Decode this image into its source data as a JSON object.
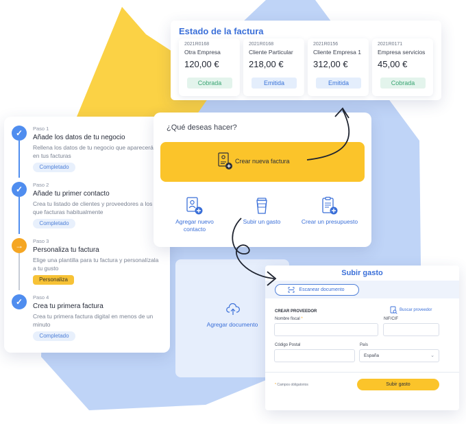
{
  "invoice_status": {
    "title": "Estado de la factura",
    "invoices": [
      {
        "id": "2021R0168",
        "client": "Otra Empresa",
        "amount": "120,00 €",
        "status": "Cobrada",
        "status_kind": "paid"
      },
      {
        "id": "2021R0168",
        "client": "Cliente Particular",
        "amount": "218,00 €",
        "status": "Emitida",
        "status_kind": "issued"
      },
      {
        "id": "2021R0156",
        "client": "Cliente Empresa 1",
        "amount": "312,00 €",
        "status": "Emitida",
        "status_kind": "issued"
      },
      {
        "id": "2021R0171",
        "client": "Empresa servicios",
        "amount": "45,00 €",
        "status": "Cobrada",
        "status_kind": "paid"
      }
    ]
  },
  "onboarding": {
    "steps": [
      {
        "number": "Paso 1",
        "title": "Añade los datos de tu negocio",
        "description": "Rellena los datos de tu negocio que aparecerán en tus facturas",
        "badge": "Completado",
        "state": "done"
      },
      {
        "number": "Paso 2",
        "title": "Añade tu primer contacto",
        "description": "Crea tu listado de clientes y proveedores a los que facturas habitualmente",
        "badge": "Completado",
        "state": "done"
      },
      {
        "number": "Paso 3",
        "title": "Personaliza tu factura",
        "description": "Elige una plantilla para tu factura y personalízala a tu gusto",
        "badge": "Personaliza",
        "state": "current"
      },
      {
        "number": "Paso 4",
        "title": "Crea tu primera factura",
        "description": "Crea tu primera factura digital en menos de un minuto",
        "badge": "Completado",
        "state": "done"
      }
    ]
  },
  "todo": {
    "question": "¿Qué deseas hacer?",
    "primary_action": "Crear nueva factura",
    "actions": [
      "Agregar nuevo contacto",
      "Subir un gasto",
      "Crear un presupuesto"
    ]
  },
  "upload": {
    "label": "Agregar documento"
  },
  "expense_form": {
    "title": "Subir gasto",
    "scan_button": "Escanear documento",
    "section": "CREAR PROVEEDOR",
    "find_supplier": "Buscar proveedor",
    "fields": {
      "fiscal_name": "Nombre fiscal",
      "nif": "NIF/CIF",
      "postal_code": "Código Postal",
      "country": "País",
      "country_value": "España"
    },
    "required_marker": "*",
    "required_note": "Campos obligatorios",
    "submit": "Subir gasto"
  },
  "colors": {
    "accent_blue": "#3a6fd8",
    "accent_yellow": "#fbc42a",
    "step_blue": "#4f8def",
    "step_active": "#f5a623"
  }
}
